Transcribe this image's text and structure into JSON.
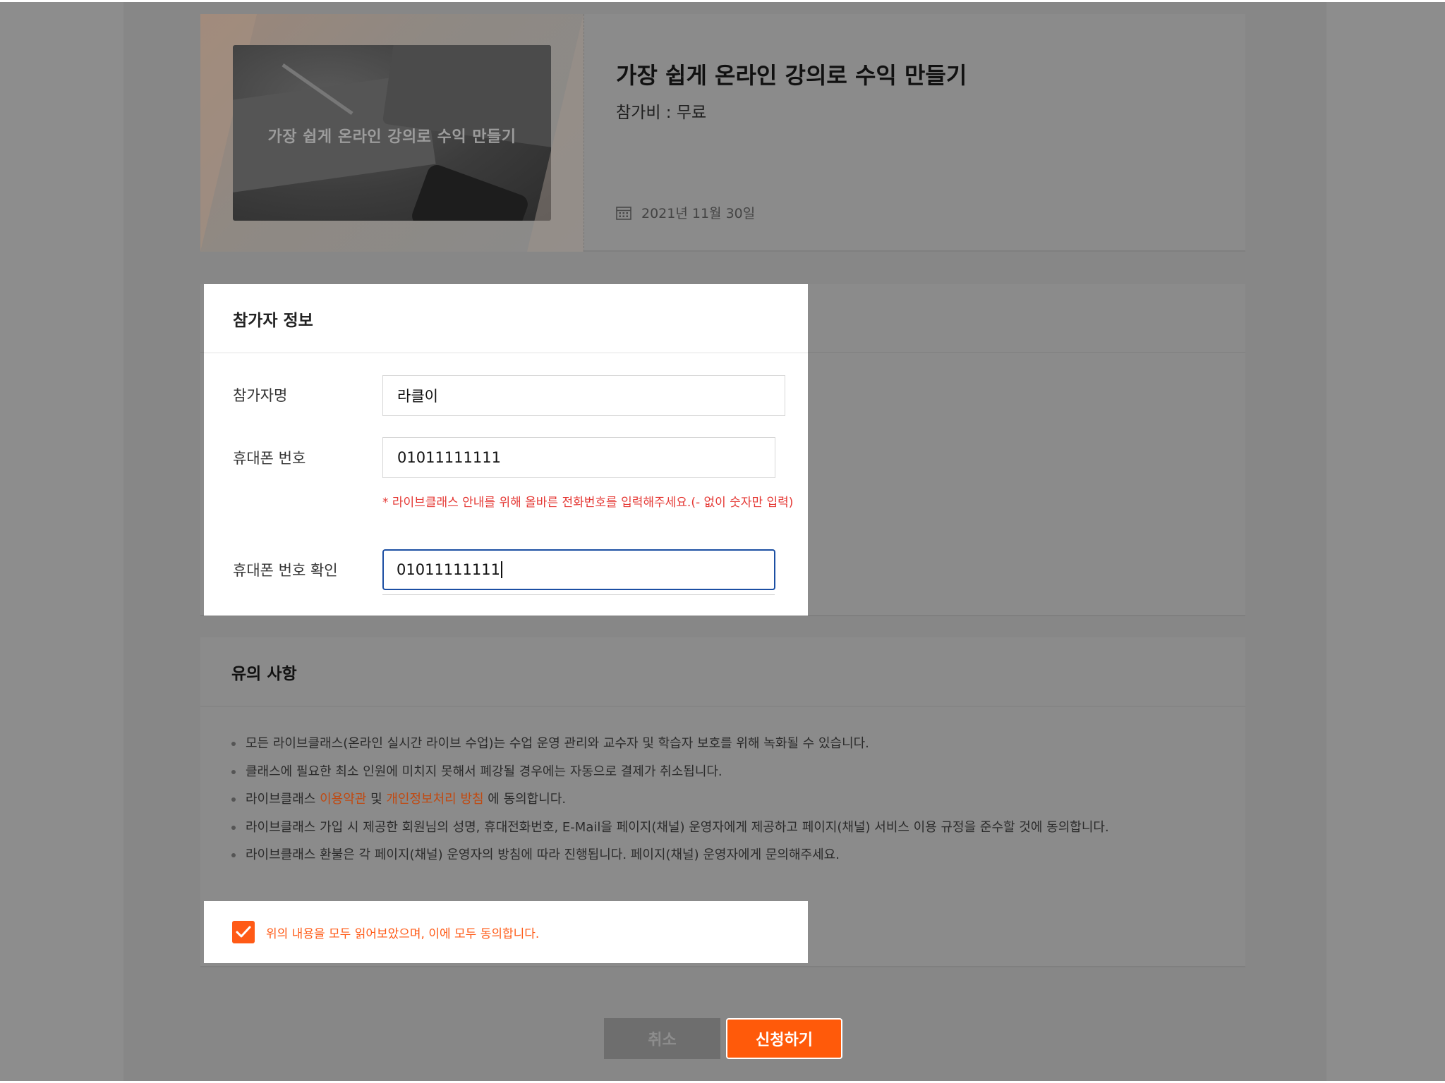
{
  "class_card": {
    "thumbnail_caption": "가장 쉽게 온라인 강의로 수익 만들기",
    "title": "가장 쉽게 온라인 강의로 수익 만들기",
    "fee": "참가비 : 무료",
    "date": "2021년 11월 30일",
    "date_icon": "calendar-icon"
  },
  "participant": {
    "heading": "참가자 정보",
    "name_label": "참가자명",
    "name_value": "라클이",
    "phone_label": "휴대폰 번호",
    "phone_value": "01011111111",
    "phone_hint": "* 라이브클래스 안내를 위해 올바른 전화번호를 입력해주세요.(- 없이 숫자만 입력)",
    "confirm_label": "휴대폰 번호 확인",
    "confirm_value": "01011111111"
  },
  "notice": {
    "heading": "유의 사항",
    "items": [
      {
        "text": "모든 라이브클래스(온라인 실시간 라이브 수업)는 수업 운영 관리와 교수자 및 학습자 보호를 위해 녹화될 수 있습니다."
      },
      {
        "text": "클래스에 필요한 최소 인원에 미치지 못해서 폐강될 경우에는 자동으로 결제가 취소됩니다."
      },
      {
        "prefix": "라이브클래스 ",
        "link1": "이용약관",
        "mid": " 및 ",
        "link2": "개인정보처리 방침",
        "suffix": " 에 동의합니다."
      },
      {
        "text": "라이브클래스 가입 시 제공한 회원님의 성명, 휴대전화번호, E-Mail을 페이지(채널) 운영자에게 제공하고 페이지(채널) 서비스 이용 규정을 준수할 것에 동의합니다."
      },
      {
        "text": "라이브클래스 환불은 각 페이지(채널) 운영자의 방침에 따라 진행됩니다. 페이지(채널) 운영자에게 문의해주세요."
      }
    ],
    "agree_text": "위의 내용을 모두 읽어보았으며, 이에 모두 동의합니다.",
    "agree_checked": true
  },
  "buttons": {
    "cancel": "취소",
    "apply": "신청하기"
  },
  "colors": {
    "accent": "#ff5a0a",
    "focus_border": "#1c4fa3",
    "hint": "#e53935",
    "dim_overlay": "#8b8b8b"
  }
}
